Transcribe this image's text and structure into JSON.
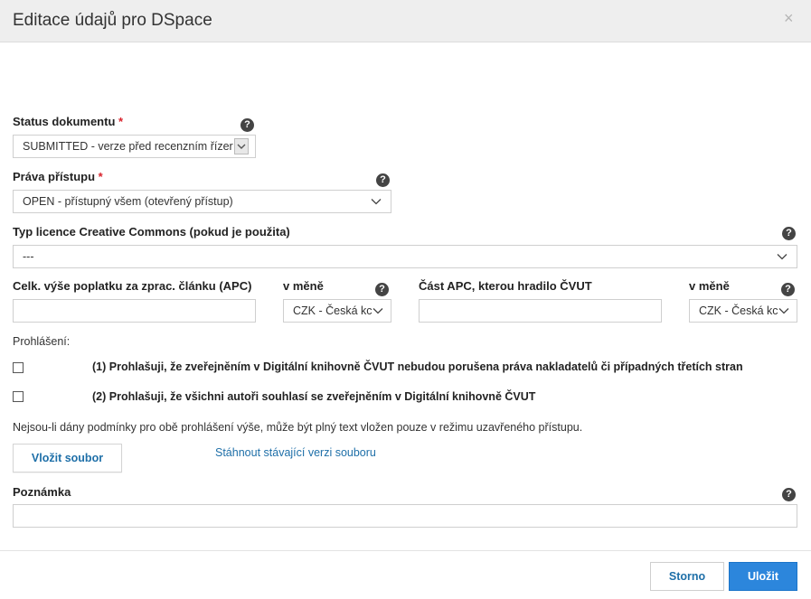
{
  "dialog": {
    "title": "Editace údajů pro DSpace",
    "close_icon": "×"
  },
  "fields": {
    "status": {
      "label": "Status dokumentu",
      "required_mark": "*",
      "value": "SUBMITTED - verze před recenzním řízer"
    },
    "access": {
      "label": "Práva přístupu",
      "required_mark": "*",
      "value": "OPEN - přístupný všem (otevřený přístup)"
    },
    "license": {
      "label": "Typ licence Creative Commons (pokud je použita)",
      "value": "---"
    },
    "apc_total": {
      "label": "Celk. výše poplatku za zprac. článku (APC)",
      "value": ""
    },
    "apc_total_currency": {
      "label": "v měně",
      "value": "CZK - Česká kc"
    },
    "apc_ctu": {
      "label": "Část APC, kterou hradilo ČVUT",
      "value": ""
    },
    "apc_ctu_currency": {
      "label": "v měně",
      "value": "CZK - Česká kc"
    },
    "note": {
      "label": "Poznámka",
      "value": ""
    }
  },
  "declarations": {
    "heading": "Prohlášení:",
    "items": [
      {
        "text": "(1) Prohlašuji, že zveřejněním v Digitální knihovně ČVUT nebudou porušena práva nakladatelů či případných třetích stran",
        "checked": false
      },
      {
        "text": "(2) Prohlašuji, že všichni autoři souhlasí se zveřejněním v Digitální knihovně ČVUT",
        "checked": false
      }
    ],
    "notice": "Nejsou-li dány podmínky pro obě prohlášení výše, může být plný text vložen pouze v režimu uzavřeného přístupu."
  },
  "file": {
    "upload_label": "Vložit soubor",
    "download_link": "Stáhnout stávající verzi souboru"
  },
  "help_icon": "?",
  "footer": {
    "cancel_label": "Storno",
    "save_label": "Uložit"
  },
  "colors": {
    "primary": "#2c86dc",
    "link": "#1e6fa8",
    "required": "#d9232d"
  }
}
